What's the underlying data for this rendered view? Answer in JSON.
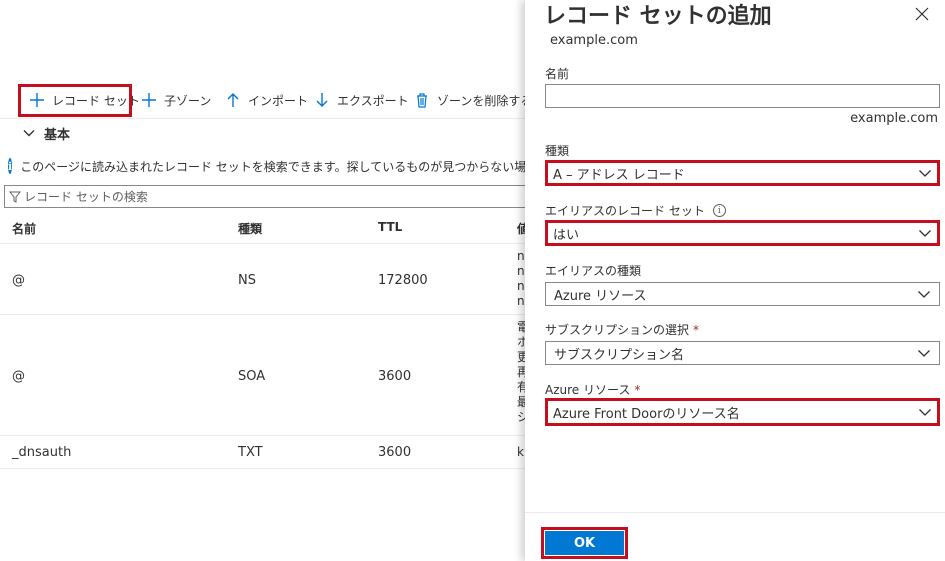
{
  "toolbar": {
    "record_set": "レコード セット",
    "child_zone": "子ゾーン",
    "import": "インポート",
    "export": "エクスポート",
    "delete_zone": "ゾーンを削除する"
  },
  "essentials": {
    "label": "基本"
  },
  "info": {
    "text": "このページに読み込まれたレコード セットを検索できます。探しているものが見つからない場合は、ス"
  },
  "search": {
    "placeholder": "レコード セットの検索"
  },
  "grid": {
    "headers": [
      "名前",
      "種類",
      "TTL",
      "値"
    ],
    "rows": [
      {
        "name": "@",
        "type": "NS",
        "ttl": "172800",
        "value": "n\nn\nn\nn"
      },
      {
        "name": "@",
        "type": "SOA",
        "ttl": "3600",
        "value": "電\nホ\n更\n再\n有\n最\nシ"
      },
      {
        "name": "_dnsauth",
        "type": "TXT",
        "ttl": "3600",
        "value": "k"
      }
    ]
  },
  "blade": {
    "title": "レコード セットの追加",
    "subtitle": "example.com",
    "name_label": "名前",
    "name_value": "",
    "name_suffix": "example.com",
    "type_label": "種類",
    "type_value": "A – アドレス レコード",
    "alias_label": "エイリアスのレコード セット",
    "alias_value": "はい",
    "alias_type_label": "エイリアスの種類",
    "alias_type_value": "Azure リソース",
    "subscription_label": "サブスクリプションの選択",
    "subscription_value": "サブスクリプション名",
    "azure_resource_label": "Azure リソース",
    "azure_resource_value": "Azure Front Doorのリソース名",
    "required_mark": "*",
    "info_glyph": "i",
    "ok_label": "OK"
  },
  "colors": {
    "accent": "#0078d4",
    "highlight": "#c50f1f",
    "required": "#a4262c",
    "border": "#8a8886"
  },
  "icons": [
    "plus-icon",
    "arrow-up-icon",
    "arrow-down-icon",
    "trash-icon",
    "chevron-down-icon",
    "info-icon",
    "filter-icon",
    "close-icon"
  ]
}
